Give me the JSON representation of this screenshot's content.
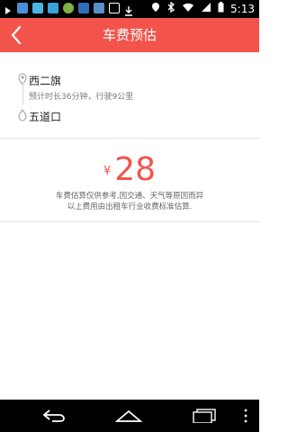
{
  "status_bar": {
    "time": "5:13",
    "icons_left": [
      "arrow-icon",
      "app-icon",
      "app-icon",
      "app-icon",
      "app-icon",
      "app-icon",
      "image-icon",
      "download-icon"
    ],
    "icons_right": [
      "location-icon",
      "bluetooth-icon",
      "wifi-icon",
      "signal-icon",
      "battery-icon"
    ]
  },
  "header": {
    "title": "车费预估",
    "bg_color": "#f2544c"
  },
  "route": {
    "origin": "西二旗",
    "destination": "五道口",
    "estimate_info": "预计时长36分钟，行驶9公里"
  },
  "fare": {
    "currency": "¥",
    "amount": "28",
    "note_line1": "车费估算仅供参考,因交通、天气等原因而异",
    "note_line2": "以上费用由出租车行业收费标准估算."
  },
  "nav_bar": {
    "buttons": [
      "back-icon",
      "home-icon",
      "recent-apps-icon",
      "menu-icon"
    ]
  }
}
